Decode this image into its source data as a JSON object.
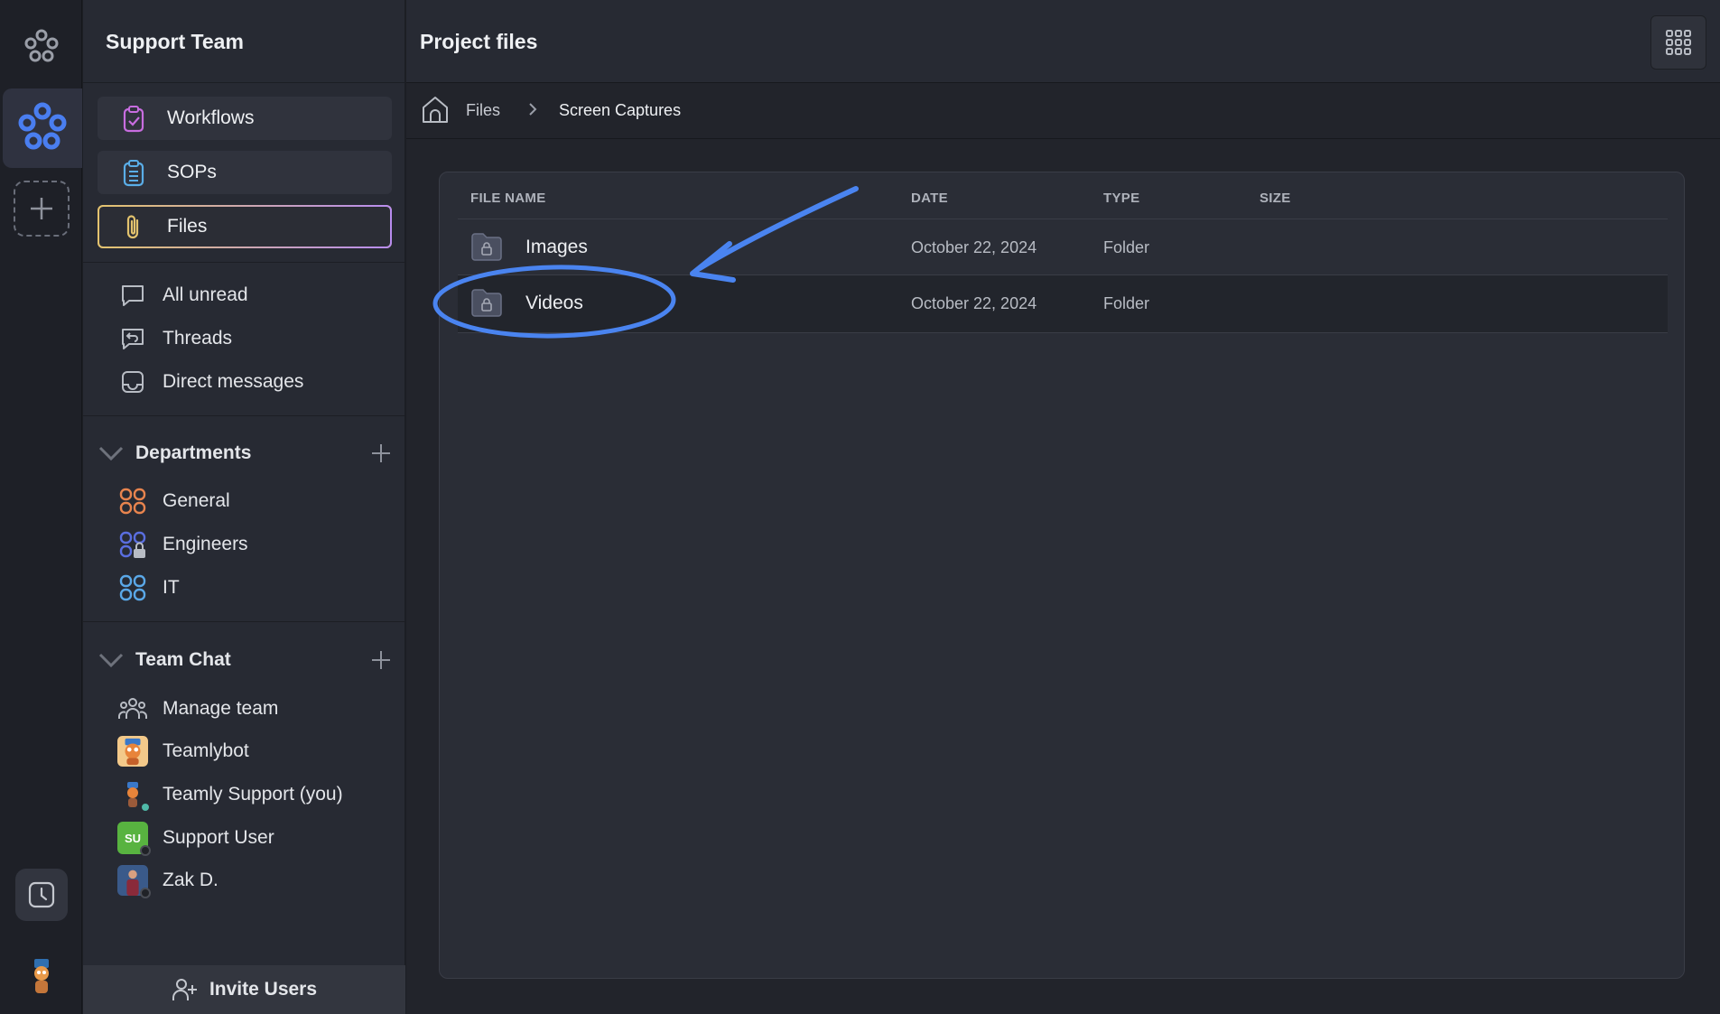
{
  "workspace": {
    "name": "Support Team"
  },
  "nav": [
    {
      "label": "Workflows",
      "icon": "clipboard-check-icon"
    },
    {
      "label": "SOPs",
      "icon": "clipboard-list-icon"
    },
    {
      "label": "Files",
      "icon": "paperclip-icon",
      "active": true
    }
  ],
  "inbox": [
    {
      "label": "All unread",
      "icon": "chat-bubble-icon"
    },
    {
      "label": "Threads",
      "icon": "reply-bubble-icon"
    },
    {
      "label": "Direct messages",
      "icon": "inbox-tray-icon"
    }
  ],
  "departments": {
    "title": "Departments",
    "items": [
      {
        "label": "General",
        "color": "#e8844e"
      },
      {
        "label": "Engineers",
        "color": "#5a6ee0"
      },
      {
        "label": "IT",
        "color": "#5aa8e8"
      }
    ]
  },
  "team_chat": {
    "title": "Team Chat",
    "items": [
      {
        "label": "Manage team"
      },
      {
        "label": "Teamlybot"
      },
      {
        "label": "Teamly Support (you)",
        "status": "#4fb9a8"
      },
      {
        "label": "Support User",
        "initials": "SU",
        "avatar_color": "#58b340",
        "status": "#202227"
      },
      {
        "label": "Zak D.",
        "status": "#202227"
      }
    ]
  },
  "invite": {
    "label": "Invite Users"
  },
  "main": {
    "title": "Project files",
    "breadcrumb": {
      "root": "Files",
      "current": "Screen Captures"
    },
    "columns": [
      "FILE NAME",
      "DATE",
      "TYPE",
      "SIZE"
    ],
    "rows": [
      {
        "name": "Images",
        "date": "October 22, 2024",
        "type": "Folder",
        "size": ""
      },
      {
        "name": "Videos",
        "date": "October 22, 2024",
        "type": "Folder",
        "size": ""
      }
    ]
  },
  "colors": {
    "accent": "#4a7ef0",
    "active_border": "#d9b86e",
    "annotation": "#4a84f0"
  }
}
